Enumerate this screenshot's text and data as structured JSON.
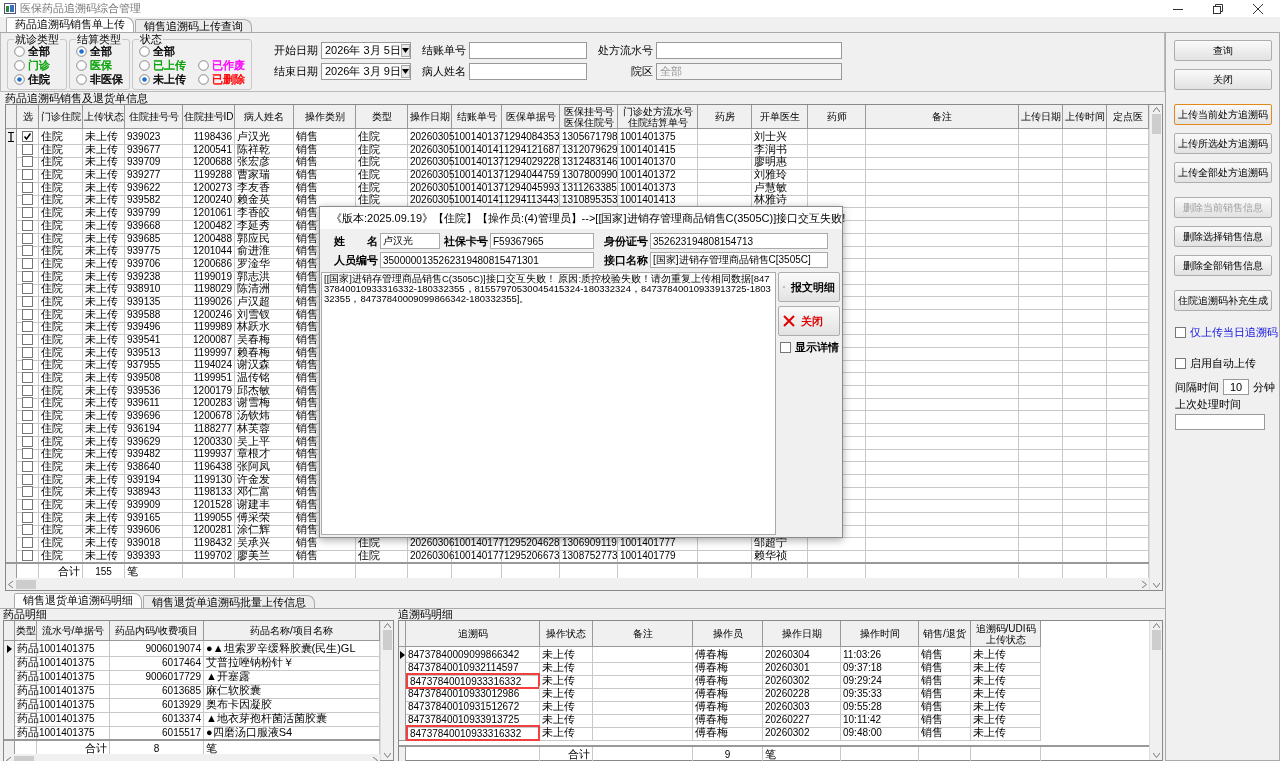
{
  "window": {
    "title": "医保药品追溯码综合管理"
  },
  "tabs": [
    {
      "label": "药品追溯码销售单上传",
      "selected": true
    },
    {
      "label": "销售追溯码上传查询",
      "selected": false
    }
  ],
  "filters": {
    "groups": [
      {
        "title": "就诊类型",
        "options": [
          {
            "label": "全部",
            "selected": false,
            "color": "#000000"
          },
          {
            "label": "门诊",
            "selected": false,
            "color": "#00a000"
          },
          {
            "label": "住院",
            "selected": true,
            "color": "#000000"
          }
        ]
      },
      {
        "title": "结算类型",
        "options": [
          {
            "label": "全部",
            "selected": true,
            "color": "#000000"
          },
          {
            "label": "医保",
            "selected": false,
            "color": "#00a000"
          },
          {
            "label": "非医保",
            "selected": false,
            "color": "#000000"
          }
        ]
      },
      {
        "title": "状态",
        "options": [
          {
            "label": "全部",
            "selected": false,
            "color": "#000000"
          },
          {
            "label": "已上传",
            "selected": false,
            "color": "#00a000"
          },
          {
            "label": "已作废",
            "selected": false,
            "color": "#ff00ff"
          },
          {
            "label": "未上传",
            "selected": true,
            "color": "#000000"
          },
          {
            "label": "已删除",
            "selected": false,
            "color": "#ff0000"
          }
        ]
      }
    ],
    "fields": [
      {
        "label": "开始日期",
        "kind": "date",
        "value": "2026年 3月 5日"
      },
      {
        "label": "结账单号",
        "kind": "text"
      },
      {
        "label": "处方流水号",
        "kind": "text"
      },
      {
        "label": "结束日期",
        "kind": "date",
        "value": "2026年 3月 9日"
      },
      {
        "label": "病人姓名",
        "kind": "text"
      },
      {
        "label": "院区",
        "kind": "select",
        "value": "全部",
        "disabled": true
      }
    ]
  },
  "sales_grid": {
    "title": "药品追溯码销售及退货单信息",
    "check_header": "选",
    "columns": [
      "门诊住院",
      "上传状态",
      "住院挂号号",
      "住院挂号ID",
      "病人姓名",
      "操作类别",
      "类型",
      "操作日期",
      "结账单号",
      "医保单据号",
      "医保挂号号医保住院号",
      "门诊处方流水号住院结算单号",
      "药房",
      "开单医生",
      "药师",
      "备注",
      "上传日期",
      "上传时间",
      "定点医"
    ],
    "rows": [
      {
        "selected": true,
        "checked": true,
        "cells": [
          "住院",
          "未上传",
          "939023",
          "1198436",
          "卢汉光",
          "销售",
          "住院",
          "20260305",
          "100140137",
          "1294084353",
          "1305671798",
          "1001401375",
          "",
          "刘士兴"
        ]
      },
      {
        "selected": false,
        "checked": false,
        "cells": [
          "住院",
          "未上传",
          "939677",
          "1200541",
          "陈祥乾",
          "销售",
          "住院",
          "20260305",
          "100140141",
          "1294121687",
          "1312079629",
          "1001401415",
          "",
          "李润书"
        ]
      },
      {
        "selected": false,
        "checked": false,
        "cells": [
          "住院",
          "未上传",
          "939709",
          "1200688",
          "张宏彦",
          "销售",
          "住院",
          "20260305",
          "100140137",
          "1294029228",
          "1312483146",
          "1001401370",
          "",
          "廖明惠"
        ]
      },
      {
        "selected": false,
        "checked": false,
        "cells": [
          "住院",
          "未上传",
          "939277",
          "1199288",
          "曹家瑞",
          "销售",
          "住院",
          "20260305",
          "100140137",
          "1294044759",
          "1307800990",
          "1001401372",
          "",
          "刘雅玲"
        ]
      },
      {
        "selected": false,
        "checked": false,
        "cells": [
          "住院",
          "未上传",
          "939622",
          "1200273",
          "李友香",
          "销售",
          "住院",
          "20260305",
          "100140137",
          "1294045993",
          "1311263385",
          "1001401373",
          "",
          "卢慧敏"
        ]
      },
      {
        "selected": false,
        "checked": false,
        "cells": [
          "住院",
          "未上传",
          "939582",
          "1200240",
          "赖金英",
          "销售",
          "住院",
          "20260305",
          "100140141",
          "1294113443",
          "1310895353",
          "1001401413",
          "",
          "林雅诗"
        ]
      },
      {
        "selected": false,
        "checked": false,
        "cells": [
          "住院",
          "未上传",
          "939799",
          "1201061",
          "李香皎",
          "销售"
        ]
      },
      {
        "selected": false,
        "checked": false,
        "cells": [
          "住院",
          "未上传",
          "939668",
          "1200482",
          "李延秀",
          "销售"
        ]
      },
      {
        "selected": false,
        "checked": false,
        "cells": [
          "住院",
          "未上传",
          "939685",
          "1200488",
          "郭应民",
          "销售"
        ]
      },
      {
        "selected": false,
        "checked": false,
        "cells": [
          "住院",
          "未上传",
          "939775",
          "1201044",
          "俞进淮",
          "销售"
        ]
      },
      {
        "selected": false,
        "checked": false,
        "cells": [
          "住院",
          "未上传",
          "939706",
          "1200686",
          "罗淦华",
          "销售"
        ]
      },
      {
        "selected": false,
        "checked": false,
        "cells": [
          "住院",
          "未上传",
          "939238",
          "1199019",
          "郭志洪",
          "销售"
        ]
      },
      {
        "selected": false,
        "checked": false,
        "cells": [
          "住院",
          "未上传",
          "938910",
          "1198029",
          "陈清洲",
          "销售"
        ]
      },
      {
        "selected": false,
        "checked": false,
        "cells": [
          "住院",
          "未上传",
          "939135",
          "1199026",
          "卢汉超",
          "销售"
        ]
      },
      {
        "selected": false,
        "checked": false,
        "cells": [
          "住院",
          "未上传",
          "939588",
          "1200246",
          "刘雪钗",
          "销售"
        ]
      },
      {
        "selected": false,
        "checked": false,
        "cells": [
          "住院",
          "未上传",
          "939496",
          "1199989",
          "林跃水",
          "销售"
        ]
      },
      {
        "selected": false,
        "checked": false,
        "cells": [
          "住院",
          "未上传",
          "939541",
          "1200087",
          "吴春梅",
          "销售"
        ]
      },
      {
        "selected": false,
        "checked": false,
        "cells": [
          "住院",
          "未上传",
          "939513",
          "1199997",
          "赖春梅",
          "销售"
        ]
      },
      {
        "selected": false,
        "checked": false,
        "cells": [
          "住院",
          "未上传",
          "937955",
          "1194024",
          "谢汉森",
          "销售"
        ]
      },
      {
        "selected": false,
        "checked": false,
        "cells": [
          "住院",
          "未上传",
          "939508",
          "1199951",
          "温传铭",
          "销售"
        ]
      },
      {
        "selected": false,
        "checked": false,
        "cells": [
          "住院",
          "未上传",
          "939536",
          "1200179",
          "邱杰敏",
          "销售"
        ]
      },
      {
        "selected": false,
        "checked": false,
        "cells": [
          "住院",
          "未上传",
          "939611",
          "1200283",
          "谢雪梅",
          "销售"
        ]
      },
      {
        "selected": false,
        "checked": false,
        "cells": [
          "住院",
          "未上传",
          "939696",
          "1200678",
          "汤钦炜",
          "销售"
        ]
      },
      {
        "selected": false,
        "checked": false,
        "cells": [
          "住院",
          "未上传",
          "936194",
          "1188277",
          "林芙蓉",
          "销售"
        ]
      },
      {
        "selected": false,
        "checked": false,
        "cells": [
          "住院",
          "未上传",
          "939629",
          "1200330",
          "吴上平",
          "销售"
        ]
      },
      {
        "selected": false,
        "checked": false,
        "cells": [
          "住院",
          "未上传",
          "939482",
          "1199937",
          "章根才",
          "销售"
        ]
      },
      {
        "selected": false,
        "checked": false,
        "cells": [
          "住院",
          "未上传",
          "938640",
          "1196438",
          "张阿凤",
          "销售"
        ]
      },
      {
        "selected": false,
        "checked": false,
        "cells": [
          "住院",
          "未上传",
          "939194",
          "1199130",
          "许金发",
          "销售"
        ]
      },
      {
        "selected": false,
        "checked": false,
        "cells": [
          "住院",
          "未上传",
          "938943",
          "1198133",
          "邓仁富",
          "销售"
        ]
      },
      {
        "selected": false,
        "checked": false,
        "cells": [
          "住院",
          "未上传",
          "939909",
          "1201528",
          "谢建丰",
          "销售"
        ]
      },
      {
        "selected": false,
        "checked": false,
        "cells": [
          "住院",
          "未上传",
          "939165",
          "1199055",
          "傅采荣",
          "销售"
        ]
      },
      {
        "selected": false,
        "checked": false,
        "cells": [
          "住院",
          "未上传",
          "939606",
          "1200281",
          "涂仁辉",
          "销售"
        ]
      },
      {
        "selected": false,
        "checked": false,
        "cells": [
          "住院",
          "未上传",
          "939018",
          "1198432",
          "吴承兴",
          "销售",
          "住院",
          "20260306",
          "100140177",
          "1295204628",
          "1306909119",
          "1001401777",
          "",
          "邹超宁"
        ]
      },
      {
        "selected": false,
        "checked": false,
        "cells": [
          "住院",
          "未上传",
          "939393",
          "1199702",
          "廖美兰",
          "销售",
          "住院",
          "20260306",
          "100140177",
          "1295206673",
          "1308752773",
          "1001401779",
          "",
          "赖华祯"
        ]
      }
    ],
    "total": {
      "label": "合计",
      "count": "155",
      "unit": "笔"
    }
  },
  "dialog": {
    "title": "《版本:2025.09.19》【住院】【操作员:(4)管理员】-->[[国家]进销存管理商品销售C(3505C)]接口交互失败!",
    "fields": [
      {
        "label": "姓　　名",
        "value": "卢汉光"
      },
      {
        "label": "社保卡号",
        "value": "F59367965"
      },
      {
        "label": "身份证号",
        "value": "352623194808154713"
      },
      {
        "label": "人员编号",
        "value": "3500000135262319480815471301"
      },
      {
        "label": "接口名称",
        "value": "[国家]进销存管理商品销售C[3505C]"
      }
    ],
    "message": "[[国家]进销存管理商品销售C(3505C)]接口交互失败！ 原因:质控校验失败！请勿重复上传相同数据[84737840010933316332-180332355，81557970530045415324-180332324，84737840010933913725-180332355，84737840009099866342-180332355]。",
    "buttons": [
      {
        "label": "报文明细",
        "kind": "detail"
      },
      {
        "label": "关闭",
        "kind": "close"
      }
    ],
    "show_details": {
      "label": "显示详情",
      "checked": false
    }
  },
  "actions": {
    "buttons": [
      {
        "label": "查询",
        "focused": false,
        "disabled": false
      },
      {
        "label": "关闭",
        "focused": false,
        "disabled": false
      },
      {
        "label": "上传当前处方追溯码",
        "focused": true,
        "disabled": false
      },
      {
        "label": "上传所选处方追溯码",
        "focused": false,
        "disabled": false
      },
      {
        "label": "上传全部处方追溯码",
        "focused": false,
        "disabled": false
      },
      {
        "label": "删除当前销售信息",
        "focused": false,
        "disabled": true
      },
      {
        "label": "删除选择销售信息",
        "focused": false,
        "disabled": false
      },
      {
        "label": "删除全部销售信息",
        "focused": false,
        "disabled": false
      },
      {
        "label": "住院追溯码补充生成",
        "focused": false,
        "disabled": false
      }
    ],
    "today_only": {
      "label": "仅上传当日追溯码",
      "checked": false
    },
    "auto_upload": {
      "label": "启用自动上传",
      "checked": false
    },
    "interval": {
      "label": "间隔时间",
      "value": "10",
      "unit": "分钟"
    },
    "last_time": {
      "label": "上次处理时间"
    }
  },
  "detail_tabs": [
    {
      "label": "销售退货单追溯码明细",
      "selected": true
    },
    {
      "label": "销售退货单追溯码批量上传信息",
      "selected": false
    }
  ],
  "drug_detail": {
    "title": "药品明细",
    "columns": [
      "类型",
      "流水号/单据号",
      "药品内码/收费项目",
      "药品名称/项目名称"
    ],
    "rows": [
      {
        "selected": true,
        "cells": [
          "药品",
          "1001401375",
          "9006019074",
          "●▲坦索罗辛缓释胶囊(民生)GL"
        ]
      },
      {
        "selected": false,
        "cells": [
          "药品",
          "1001401375",
          "6017464",
          "艾普拉唑钠粉针￥"
        ]
      },
      {
        "selected": false,
        "cells": [
          "药品",
          "1001401375",
          "9006017729",
          "▲开塞露"
        ]
      },
      {
        "selected": false,
        "cells": [
          "药品",
          "1001401375",
          "6013685",
          "麻仁软胶囊"
        ]
      },
      {
        "selected": false,
        "cells": [
          "药品",
          "1001401375",
          "6013929",
          "奥布卡因凝胶"
        ]
      },
      {
        "selected": false,
        "cells": [
          "药品",
          "1001401375",
          "6013374",
          "▲地衣芽孢杆菌活菌胶囊"
        ]
      },
      {
        "selected": false,
        "cells": [
          "药品",
          "1001401375",
          "6015517",
          "●四磨汤口服液S4"
        ]
      }
    ],
    "total": {
      "label": "合计",
      "count": "8",
      "unit": "笔"
    }
  },
  "trace_detail": {
    "title": "追溯码明细",
    "columns": [
      "追溯码",
      "操作状态",
      "备注",
      "操作员",
      "操作日期",
      "操作时间",
      "销售/退货",
      "追溯码/UDI码上传状态"
    ],
    "rows": [
      {
        "selected": true,
        "highlighted": false,
        "cells": [
          "84737840009099866342",
          "未上传",
          "",
          "傅春梅",
          "20260304",
          "11:03:26",
          "销售",
          "未上传"
        ]
      },
      {
        "selected": false,
        "highlighted": false,
        "cells": [
          "84737840010932114597",
          "未上传",
          "",
          "傅春梅",
          "20260301",
          "09:37:18",
          "销售",
          "未上传"
        ]
      },
      {
        "selected": false,
        "highlighted": true,
        "cells": [
          "84737840010933316332",
          "未上传",
          "",
          "傅春梅",
          "20260302",
          "09:29:24",
          "销售",
          "未上传"
        ]
      },
      {
        "selected": false,
        "highlighted": false,
        "cells": [
          "84737840010933012986",
          "未上传",
          "",
          "傅春梅",
          "20260228",
          "09:35:33",
          "销售",
          "未上传"
        ]
      },
      {
        "selected": false,
        "highlighted": false,
        "cells": [
          "84737840010931512672",
          "未上传",
          "",
          "傅春梅",
          "20260303",
          "09:55:28",
          "销售",
          "未上传"
        ]
      },
      {
        "selected": false,
        "highlighted": false,
        "cells": [
          "84737840010933913725",
          "未上传",
          "",
          "傅春梅",
          "20260227",
          "10:11:42",
          "销售",
          "未上传"
        ]
      },
      {
        "selected": false,
        "highlighted": true,
        "cells": [
          "84737840010933316332",
          "未上传",
          "",
          "傅春梅",
          "20260302",
          "09:48:00",
          "销售",
          "未上传"
        ]
      }
    ],
    "total": {
      "label": "合计",
      "count": "9",
      "unit": "笔"
    }
  }
}
